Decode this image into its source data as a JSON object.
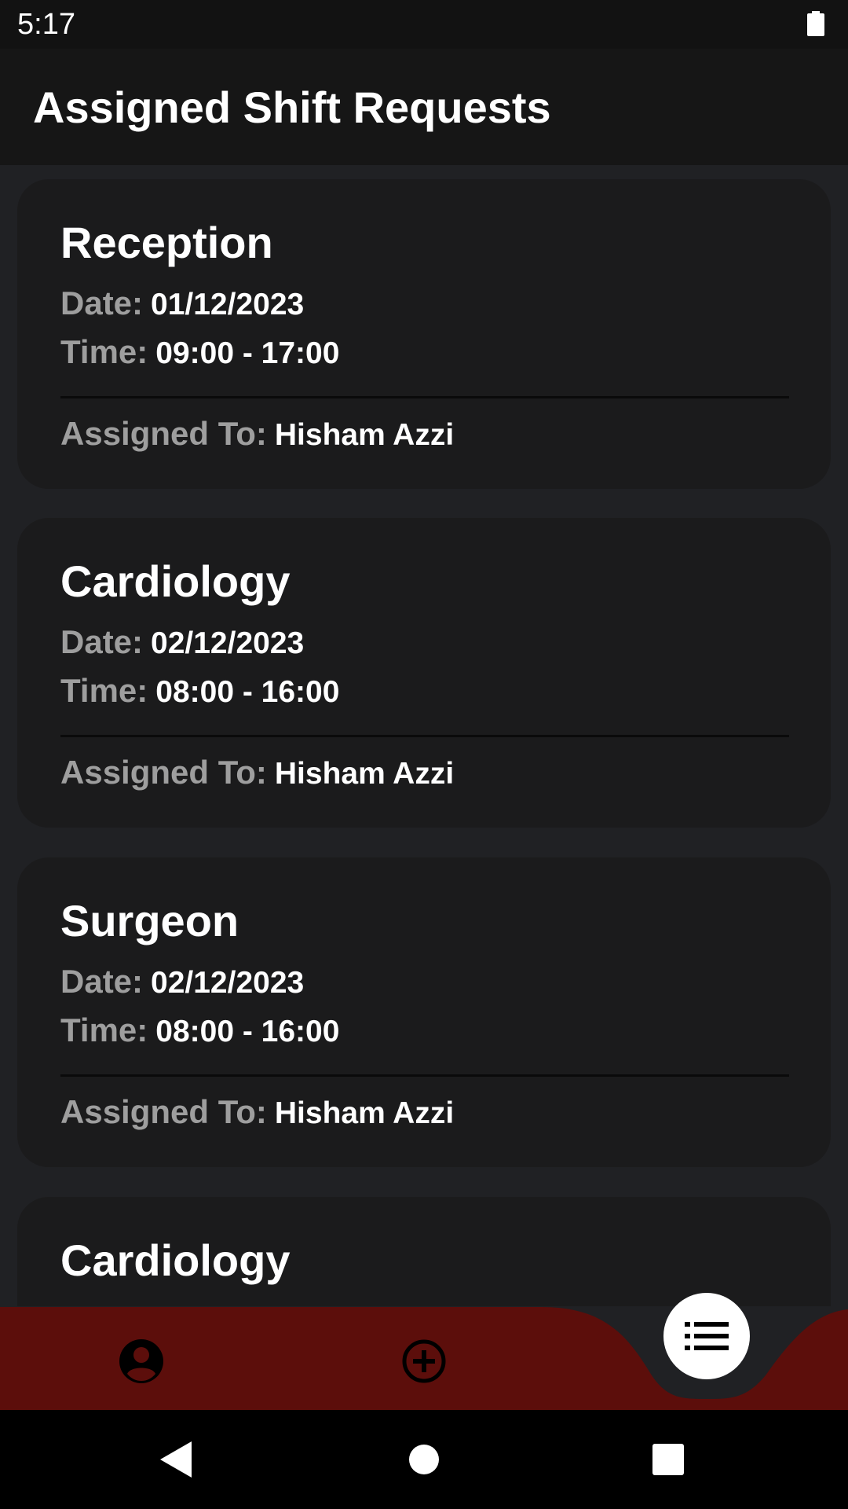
{
  "status_bar": {
    "time": "5:17",
    "battery_icon": "battery-full-icon"
  },
  "app_bar": {
    "title": "Assigned Shift Requests"
  },
  "labels": {
    "date": "Date:",
    "time": "Time:",
    "assigned_to": "Assigned To:"
  },
  "shifts": [
    {
      "department": "Reception",
      "date": "01/12/2023",
      "time": "09:00 - 17:00",
      "assigned_to": "Hisham Azzi"
    },
    {
      "department": "Cardiology",
      "date": "02/12/2023",
      "time": "08:00 - 16:00",
      "assigned_to": "Hisham Azzi"
    },
    {
      "department": "Surgeon",
      "date": "02/12/2023",
      "time": "08:00 - 16:00",
      "assigned_to": "Hisham Azzi"
    },
    {
      "department": "Cardiology"
    }
  ],
  "bottom_nav": {
    "items": [
      {
        "icon": "profile-icon"
      },
      {
        "icon": "add-circle-icon"
      },
      {
        "icon": "list-icon",
        "selected": true
      }
    ],
    "bar_color": "#5c0e0b"
  },
  "system_nav": {
    "back": "back-icon",
    "home": "home-icon",
    "recents": "recents-icon"
  }
}
